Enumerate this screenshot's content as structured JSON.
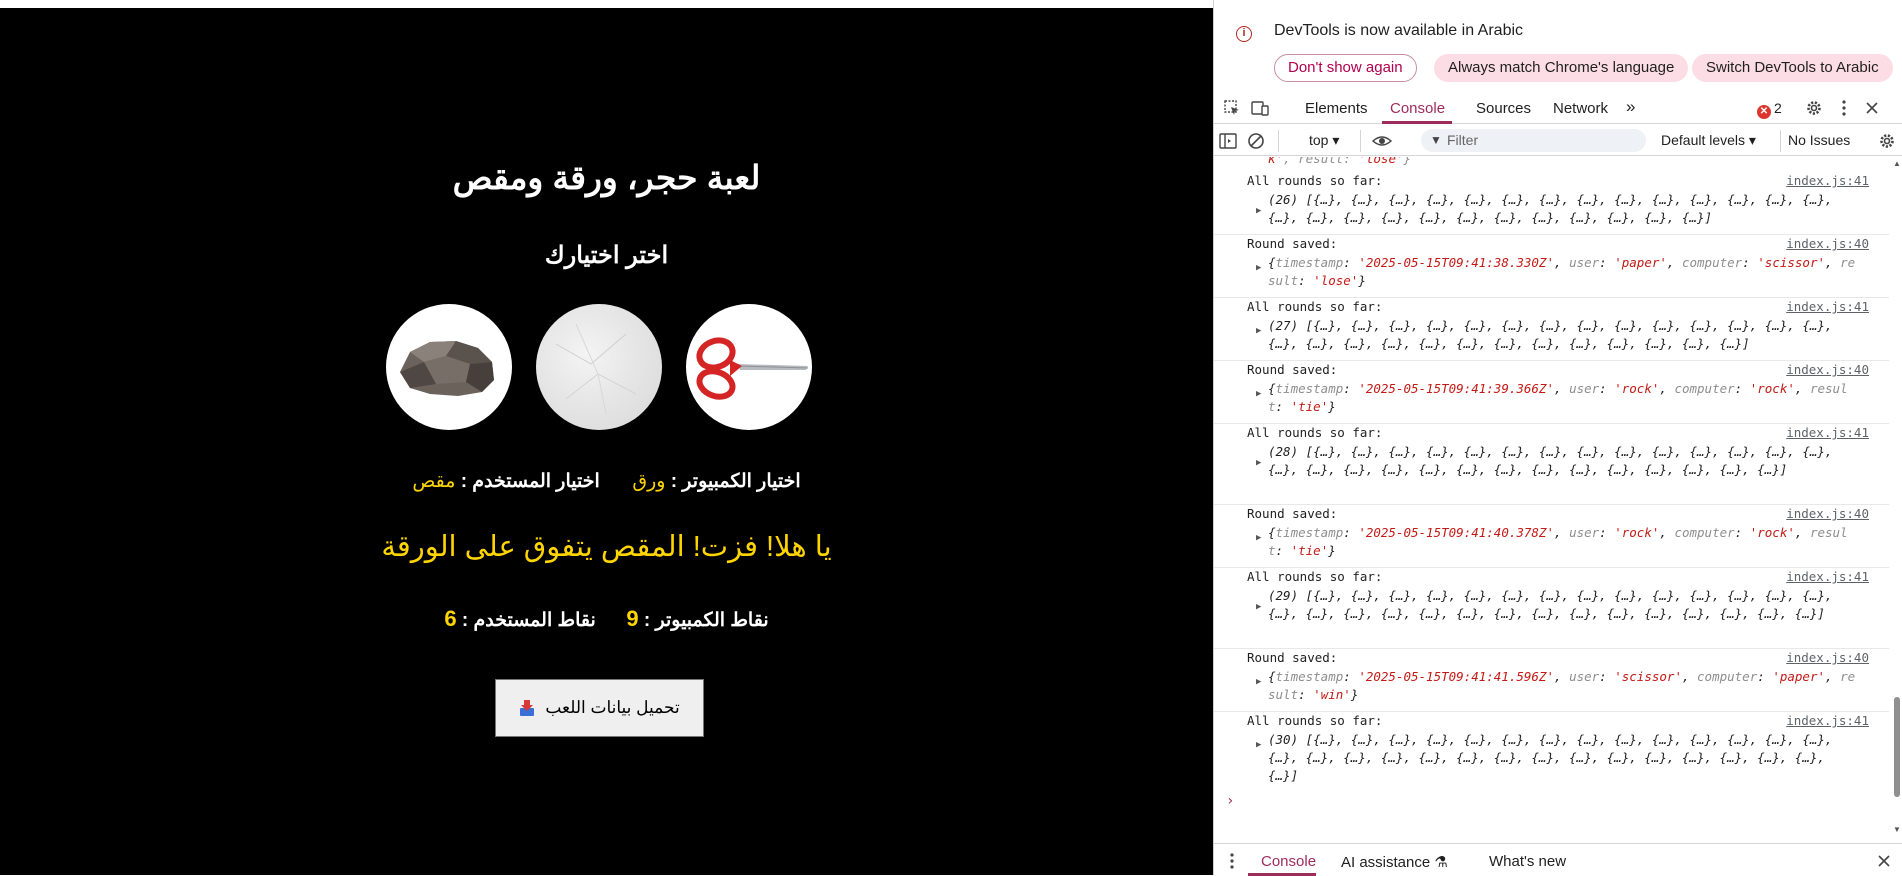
{
  "game": {
    "title": "لعبة حجر، ورقة ومقص",
    "subtitle": "اختر اختيارك",
    "choices": [
      {
        "id": "rock",
        "name": "rock-choice"
      },
      {
        "id": "paper",
        "name": "paper-choice"
      },
      {
        "id": "scissor",
        "name": "scissor-choice"
      }
    ],
    "computer_choice_label": "اختيار الكمبيوتر :",
    "computer_choice_value": "ورق",
    "user_choice_label": "اختيار المستخدم :",
    "user_choice_value": "مقص",
    "result_text": "يا هلا! فزت! المقص يتفوق على الورقة",
    "computer_score_label": "نقاط الكمبيوتر :",
    "computer_score": "9",
    "user_score_label": "نقاط المستخدم :",
    "user_score": "6",
    "download_label": "تحميل بيانات اللعب"
  },
  "devtools": {
    "infobar": {
      "message": "DevTools is now available in Arabic",
      "btn_dont_show": "Don't show again",
      "btn_match": "Always match Chrome's language",
      "btn_switch": "Switch DevTools to Arabic"
    },
    "tabs": [
      "Elements",
      "Console",
      "Sources",
      "Network"
    ],
    "active_tab": "Console",
    "error_count": "2",
    "toolbar": {
      "context": "top",
      "filter_placeholder": "Filter",
      "levels": "Default levels",
      "issues": "No Issues"
    },
    "clipped_top": "k', result: 'lose'}",
    "entries": [
      {
        "head": "All rounds so far:",
        "src": "index.js:41",
        "count": "(26)",
        "body": " [{…}, {…}, {…}, {…}, {…}, {…}, {…}, {…}, {…}, {…}, {…}, {…}, {…}, {…}, {…}, {…}, {…}, {…}, {…}, {…}, {…}, {…}, {…}, {…}, {…}, {…}]"
      },
      {
        "head": "Round saved:",
        "src": "index.js:40",
        "timestamp": "'2025-05-15T09:41:38.330Z'",
        "user": "'paper'",
        "computer": "'scissor'",
        "result": "'lose'"
      },
      {
        "head": "All rounds so far:",
        "src": "index.js:41",
        "count": "(27)",
        "body": " [{…}, {…}, {…}, {…}, {…}, {…}, {…}, {…}, {…}, {…}, {…}, {…}, {…}, {…}, {…}, {…}, {…}, {…}, {…}, {…}, {…}, {…}, {…}, {…}, {…}, {…}, {…}]"
      },
      {
        "head": "Round saved:",
        "src": "index.js:40",
        "timestamp": "'2025-05-15T09:41:39.366Z'",
        "user": "'rock'",
        "computer": "'rock'",
        "result": "'tie'"
      },
      {
        "head": "All rounds so far:",
        "src": "index.js:41",
        "count": "(28)",
        "body": " [{…}, {…}, {…}, {…}, {…}, {…}, {…}, {…}, {…}, {…}, {…}, {…}, {…}, {…}, {…}, {…}, {…}, {…}, {…}, {…}, {…}, {…}, {…}, {…}, {…}, {…}, {…}, {…}]"
      },
      {
        "head": "Round saved:",
        "src": "index.js:40",
        "timestamp": "'2025-05-15T09:41:40.378Z'",
        "user": "'rock'",
        "computer": "'rock'",
        "result": "'tie'"
      },
      {
        "head": "All rounds so far:",
        "src": "index.js:41",
        "count": "(29)",
        "body": " [{…}, {…}, {…}, {…}, {…}, {…}, {…}, {…}, {…}, {…}, {…}, {…}, {…}, {…}, {…}, {…}, {…}, {…}, {…}, {…}, {…}, {…}, {…}, {…}, {…}, {…}, {…}, {…}, {…}]"
      },
      {
        "head": "Round saved:",
        "src": "index.js:40",
        "timestamp": "'2025-05-15T09:41:41.596Z'",
        "user": "'scissor'",
        "computer": "'paper'",
        "result": "'win'"
      },
      {
        "head": "All rounds so far:",
        "src": "index.js:41",
        "count": "(30)",
        "body": " [{…}, {…}, {…}, {…}, {…}, {…}, {…}, {…}, {…}, {…}, {…}, {…}, {…}, {…}, {…}, {…}, {…}, {…}, {…}, {…}, {…}, {…}, {…}, {…}, {…}, {…}, {…}, {…}, {…}, {…}]"
      }
    ],
    "drawer_tabs": [
      "Console",
      "AI assistance",
      "What's new"
    ]
  }
}
